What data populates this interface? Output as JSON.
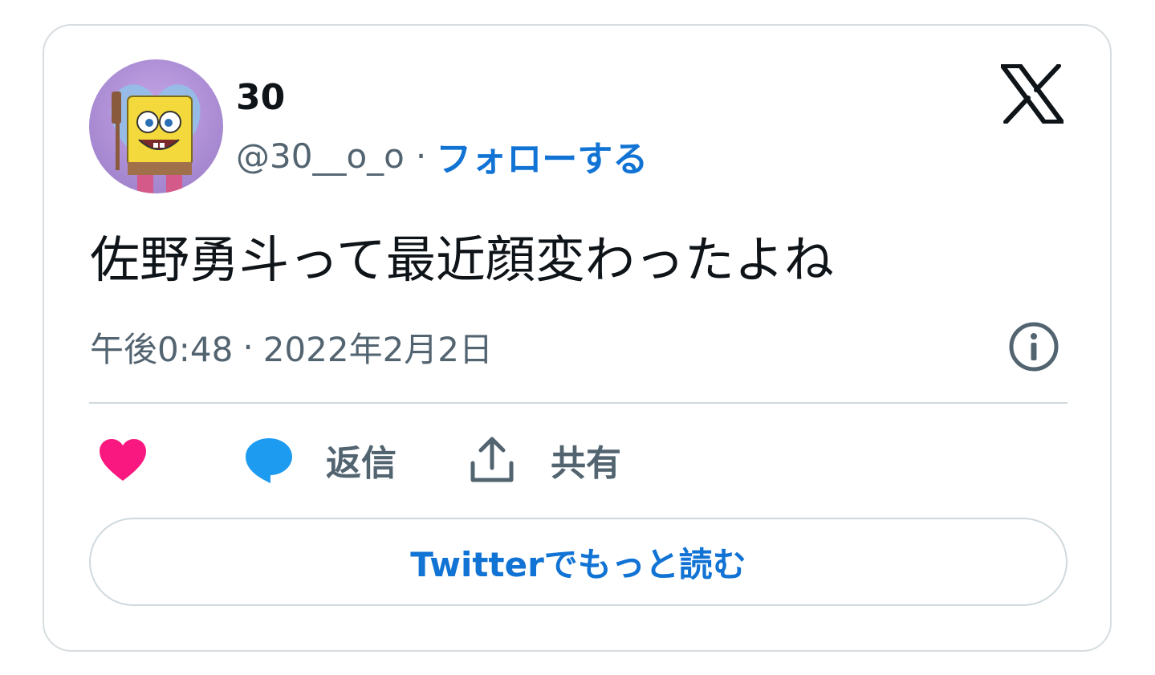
{
  "author": {
    "display_name": "30",
    "handle": "@30__o_o",
    "separator": "·",
    "follow_label": "フォローする"
  },
  "tweet": {
    "text": "佐野勇斗って最近顔変わったよね",
    "time": "午後0:48",
    "separator": "·",
    "date": "2022年2月2日"
  },
  "actions": {
    "like_icon": "heart-icon",
    "reply_icon": "reply-bubble-icon",
    "reply_label": "返信",
    "share_icon": "share-icon",
    "share_label": "共有"
  },
  "footer": {
    "read_more_label": "Twitterでもっと読む"
  },
  "colors": {
    "accent_blue": "#1173d4",
    "like_pink": "#f91880",
    "reply_blue": "#1d9bf0",
    "muted_text": "#536471",
    "border": "#cfd9de"
  }
}
